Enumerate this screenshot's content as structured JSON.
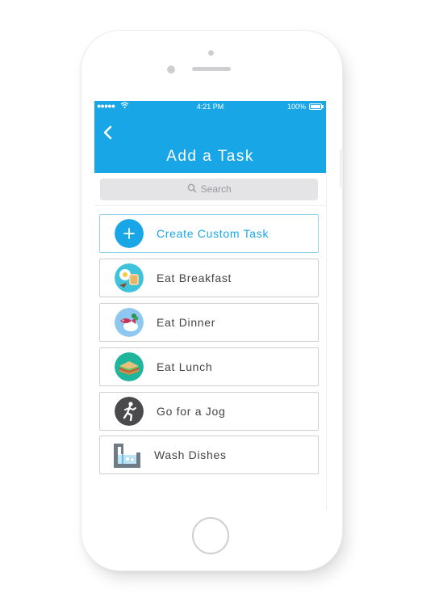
{
  "status_bar": {
    "signal": "●●●●●",
    "time": "4:21 PM",
    "battery": "100%"
  },
  "nav": {
    "title": "Add a Task"
  },
  "search": {
    "placeholder": "Search"
  },
  "tasks": [
    {
      "label": "Create Custom Task",
      "icon": "plus-icon"
    },
    {
      "label": "Eat Breakfast",
      "icon": "breakfast-icon"
    },
    {
      "label": "Eat Dinner",
      "icon": "dinner-icon"
    },
    {
      "label": "Eat Lunch",
      "icon": "sandwich-icon"
    },
    {
      "label": "Go for a Jog",
      "icon": "jogger-icon"
    },
    {
      "label": "Wash Dishes",
      "icon": "sink-icon"
    }
  ],
  "colors": {
    "accent": "#18a6e6",
    "row_border": "#cfcfd2",
    "text": "#434346"
  }
}
